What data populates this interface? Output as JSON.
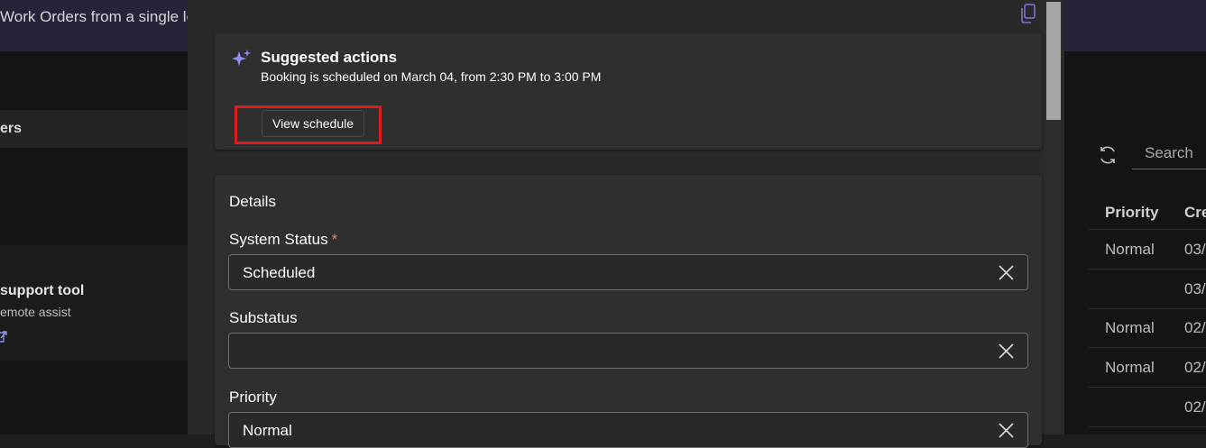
{
  "background": {
    "header_title": "Work Orders from a single lo",
    "left_section_header": "ers",
    "tool_card": {
      "title": "support tool",
      "subtitle": "emote assist"
    },
    "search": {
      "placeholder": "Search"
    },
    "table": {
      "columns": [
        "Priority",
        "Cre"
      ],
      "rows": [
        {
          "priority": "Normal",
          "created": "03/"
        },
        {
          "priority": "",
          "created": "03/"
        },
        {
          "priority": "Normal",
          "created": "02/"
        },
        {
          "priority": "Normal",
          "created": "02/"
        },
        {
          "priority": "",
          "created": "02/"
        }
      ]
    }
  },
  "dialog": {
    "suggested_actions": {
      "title": "Suggested actions",
      "description": "Booking is scheduled on March 04, from 2:30 PM to 3:00 PM",
      "button_label": "View schedule"
    },
    "details": {
      "section_title": "Details",
      "fields": [
        {
          "label": "System Status",
          "required_marker": "*",
          "value": "Scheduled"
        },
        {
          "label": "Substatus",
          "value": ""
        },
        {
          "label": "Priority",
          "value": "Normal"
        }
      ]
    }
  },
  "colors": {
    "accent_purple": "#8f8ff0",
    "highlight_red": "#e01b1b",
    "required_red": "#e37d80"
  },
  "icons": [
    "sparkle-icon",
    "copy-icon",
    "clear-icon",
    "refresh-icon",
    "external-link-icon"
  ]
}
